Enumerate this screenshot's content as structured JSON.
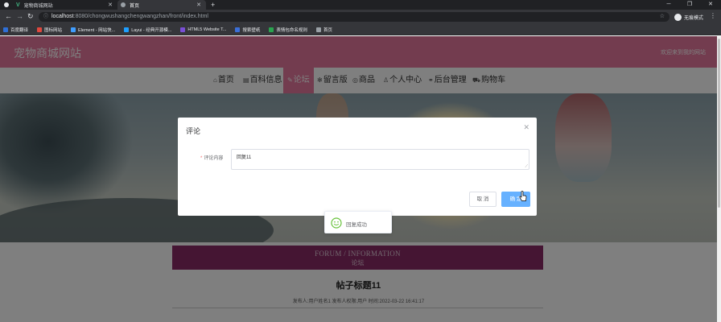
{
  "browser": {
    "tabs": [
      {
        "title": ""
      },
      {
        "title": "宠物商城网站"
      },
      {
        "title": "首页"
      }
    ],
    "url_host": "localhost",
    "url_rest": ":8080/chongwushangchengwangzhan/front/index.html",
    "profile_label": "无痕模式",
    "bookmarks": [
      {
        "label": "百度翻译",
        "color": "#2f6fd6"
      },
      {
        "label": "图标网站",
        "color": "#e0483e"
      },
      {
        "label": "Element - 网站快...",
        "color": "#409eff"
      },
      {
        "label": "Layui - 经典开源模...",
        "color": "#1e9fff"
      },
      {
        "label": "HTML5 Website T...",
        "color": "#7a4fd6"
      },
      {
        "label": "搜索壁纸",
        "color": "#3b6fd8"
      },
      {
        "label": "表情包命名规则",
        "color": "#2aa44f"
      },
      {
        "label": "首页",
        "color": "#9aa0a6"
      }
    ]
  },
  "site": {
    "title": "宠物商城网站",
    "welcome": "欢迎来到我的网站",
    "nav": [
      {
        "label": "首页"
      },
      {
        "label": "百科信息"
      },
      {
        "label": "论坛"
      },
      {
        "label": "留言版"
      },
      {
        "label": "商品"
      },
      {
        "label": "个人中心"
      },
      {
        "label": "后台管理"
      },
      {
        "label": "购物车"
      }
    ],
    "forum_en": "FORUM / INFORMATION",
    "forum_cn": "论坛",
    "post_title": "帖子标题11",
    "post_meta": "发布人:用户姓名1   发布人权限:用户   时间:2022-03-22 16:41:17"
  },
  "dialog": {
    "title": "评论",
    "label": "评论内容",
    "content": "回复11",
    "cancel": "取 消",
    "ok": "确 定"
  },
  "toast": {
    "message": "回复成功"
  },
  "colors": {
    "brand": "#e6799e",
    "forum_bar": "#8b2a67",
    "primary": "#409eff"
  }
}
